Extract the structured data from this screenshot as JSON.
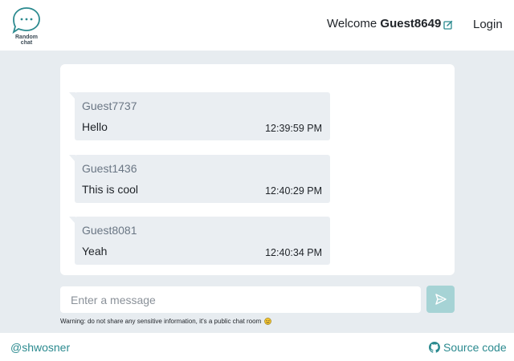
{
  "header": {
    "logo_line1": "Random",
    "logo_line2": "chat",
    "welcome_prefix": "Welcome",
    "username": "Guest8649",
    "login_label": "Login"
  },
  "messages": [
    {
      "author": "Guest7737",
      "text": "Hello",
      "time": "12:39:59 PM"
    },
    {
      "author": "Guest1436",
      "text": "This is cool",
      "time": "12:40:29 PM"
    },
    {
      "author": "Guest8081",
      "text": "Yeah",
      "time": "12:40:34 PM"
    }
  ],
  "composer": {
    "placeholder": "Enter a message",
    "warning": "Warning: do not share any sensitive information, it's a public chat room"
  },
  "footer": {
    "handle": "@shwosner",
    "source_label": "Source code"
  },
  "colors": {
    "accent": "#2b8a8f",
    "send_button": "#a6d3d5",
    "background": "#e7ecf0"
  },
  "icons": {
    "logo": "chat-bubble-icon",
    "edit": "edit-icon",
    "send": "send-icon",
    "emoji": "smile-emoji-icon",
    "github": "github-icon"
  }
}
